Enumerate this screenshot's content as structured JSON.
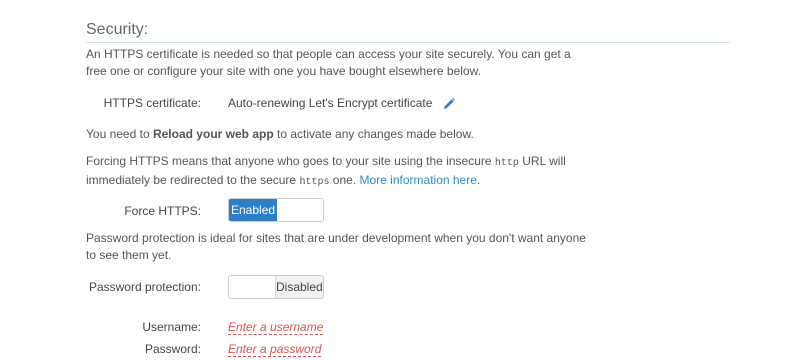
{
  "section": {
    "title": "Security:"
  },
  "intro": "An HTTPS certificate is needed so that people can access your site securely. You can get a free one or configure your site with one you have bought elsewhere below.",
  "certificate": {
    "label": "HTTPS certificate:",
    "value": "Auto-renewing Let's Encrypt certificate",
    "edit_icon": "pencil-icon"
  },
  "reload_note": {
    "prefix": "You need to ",
    "bold": "Reload your web app",
    "suffix": " to activate any changes made below."
  },
  "force_note": {
    "part1": "Forcing HTTPS means that anyone who goes to your site using the insecure ",
    "code1": "http",
    "part2": " URL will immediately be redirected to the secure ",
    "code2": "https",
    "part3": " one. ",
    "link": "More information here",
    "part4": "."
  },
  "force_https": {
    "label": "Force HTTPS:",
    "state": "Enabled"
  },
  "password_note": "Password protection is ideal for sites that are under development when you don't want anyone to see them yet.",
  "password_protection": {
    "label": "Password protection:",
    "state": "Disabled"
  },
  "username": {
    "label": "Username:",
    "placeholder": "Enter a username"
  },
  "password": {
    "label": "Password:",
    "placeholder": "Enter a password"
  },
  "colors": {
    "accent": "#2d7fc7",
    "link": "#2b8cc4",
    "placeholder_red": "#d9534f",
    "rule": "#cfe3ec"
  }
}
